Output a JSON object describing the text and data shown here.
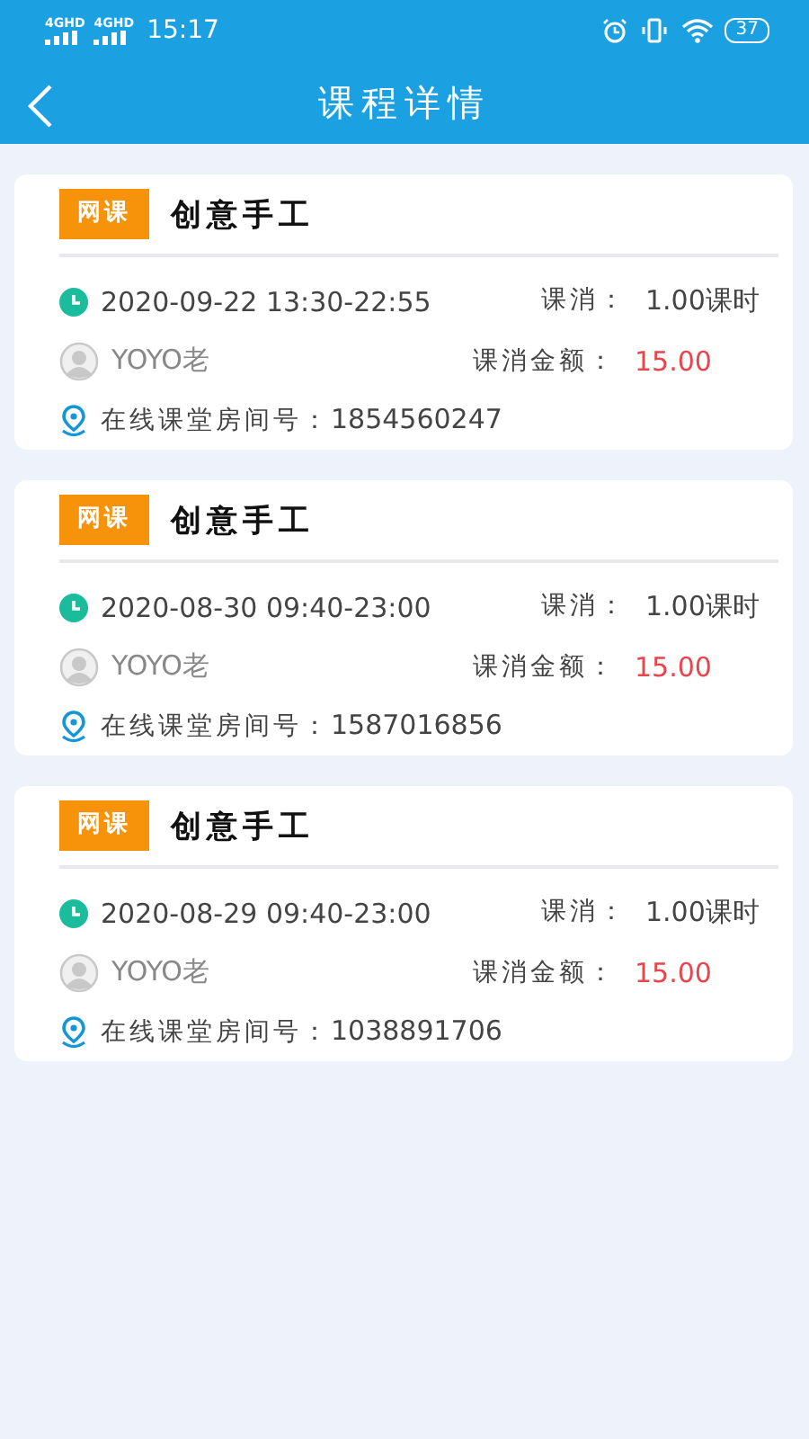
{
  "status_bar": {
    "networks": [
      "4GHD",
      "4GHD"
    ],
    "time": "15:17",
    "battery": "37"
  },
  "header": {
    "title": "课程详情"
  },
  "courses": [
    {
      "tag": "网课",
      "title": "创意手工",
      "time": "2020-09-22 13:30-22:55",
      "hours_label": "课消：",
      "hours": "1.00课时",
      "teacher": "YOYO老",
      "amount_label": "课消金额：",
      "amount": "15.00",
      "room_label": "在线课堂房间号：",
      "room": "1854560247"
    },
    {
      "tag": "网课",
      "title": "创意手工",
      "time": "2020-08-30 09:40-23:00",
      "hours_label": "课消：",
      "hours": "1.00课时",
      "teacher": "YOYO老",
      "amount_label": "课消金额：",
      "amount": "15.00",
      "room_label": "在线课堂房间号：",
      "room": "1587016856"
    },
    {
      "tag": "网课",
      "title": "创意手工",
      "time": "2020-08-29 09:40-23:00",
      "hours_label": "课消：",
      "hours": "1.00课时",
      "teacher": "YOYO老",
      "amount_label": "课消金额：",
      "amount": "15.00",
      "room_label": "在线课堂房间号：",
      "room": "1038891706"
    }
  ]
}
